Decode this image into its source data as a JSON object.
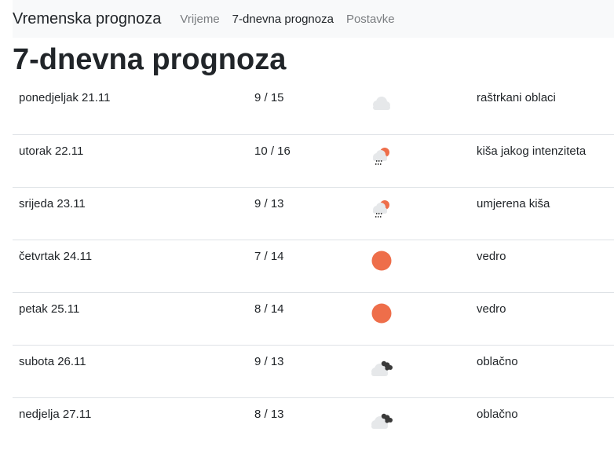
{
  "navbar": {
    "brand": "Vremenska prognoza",
    "links": [
      {
        "label": "Vrijeme",
        "active": false
      },
      {
        "label": "7-dnevna prognoza",
        "active": true
      },
      {
        "label": "Postavke",
        "active": false
      }
    ]
  },
  "page_title": "7-dnevna prognoza",
  "colors": {
    "sun": "#ee6e4a",
    "cloud_light": "#e6e8ea",
    "cloud_dark": "#3a3a3a",
    "rain": "#444444",
    "row_border": "#dee2e6",
    "navbar_bg": "#f8f9fa"
  },
  "forecast": [
    {
      "day": "ponedjeljak 21.11",
      "temp": "9 / 15",
      "icon": "scattered-clouds-icon",
      "desc": "raštrkani oblaci"
    },
    {
      "day": "utorak 22.11",
      "temp": "10 / 16",
      "icon": "rain-icon",
      "desc": "kiša jakog intenziteta"
    },
    {
      "day": "srijeda 23.11",
      "temp": "9 / 13",
      "icon": "rain-icon",
      "desc": "umjerena kiša"
    },
    {
      "day": "četvrtak 24.11",
      "temp": "7 / 14",
      "icon": "clear-sky-icon",
      "desc": "vedro"
    },
    {
      "day": "petak 25.11",
      "temp": "8 / 14",
      "icon": "clear-sky-icon",
      "desc": "vedro"
    },
    {
      "day": "subota 26.11",
      "temp": "9 / 13",
      "icon": "broken-clouds-icon",
      "desc": "oblačno"
    },
    {
      "day": "nedjelja 27.11",
      "temp": "8 / 13",
      "icon": "broken-clouds-icon",
      "desc": "oblačno"
    }
  ]
}
